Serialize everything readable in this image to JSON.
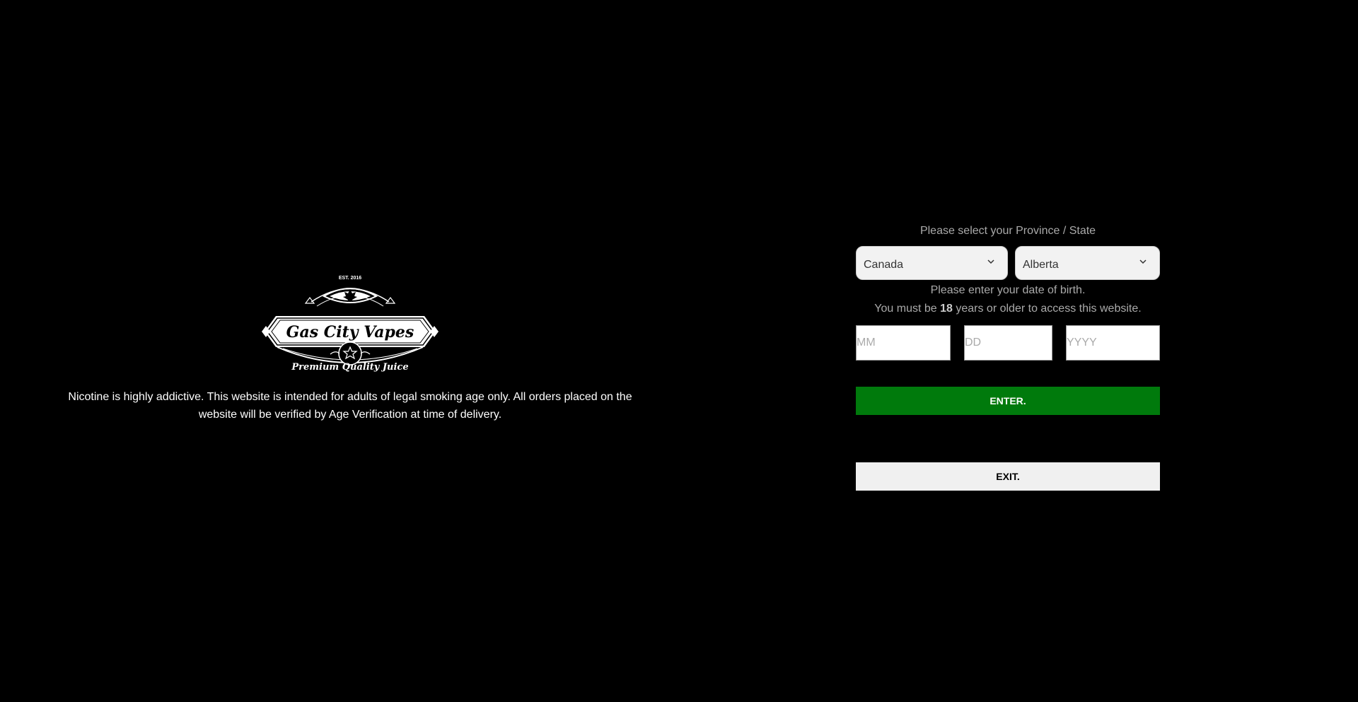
{
  "brand": {
    "logo_est": "EST. 2016",
    "logo_name": "Gas City Vapes",
    "logo_tagline": "Premium Quality Juice"
  },
  "disclaimer": {
    "line1": "Nicotine is highly addictive. This website is intended for adults of legal smoking age only. All orders placed on the",
    "line2": "website will be verified by Age Verification at time of delivery."
  },
  "age_gate": {
    "province_prompt": "Please select your Province / State",
    "country_selected": "Canada",
    "province_selected": "Alberta",
    "dob_prompt": "Please enter your date of birth.",
    "age_prefix": "You must be ",
    "min_age": "18",
    "age_suffix": " years or older to access this website.",
    "mm_placeholder": "MM",
    "dd_placeholder": "DD",
    "yyyy_placeholder": "YYYY",
    "enter_label": "ENTER.",
    "exit_label": "EXIT."
  },
  "colors": {
    "background": "#000000",
    "enter_button": "#007a0c",
    "exit_button": "#f0f0f0"
  },
  "icons": {
    "select_arrow": "chevron-down-icon",
    "logo_leaf": "maple-leaf-icon",
    "logo_star": "star-icon"
  }
}
